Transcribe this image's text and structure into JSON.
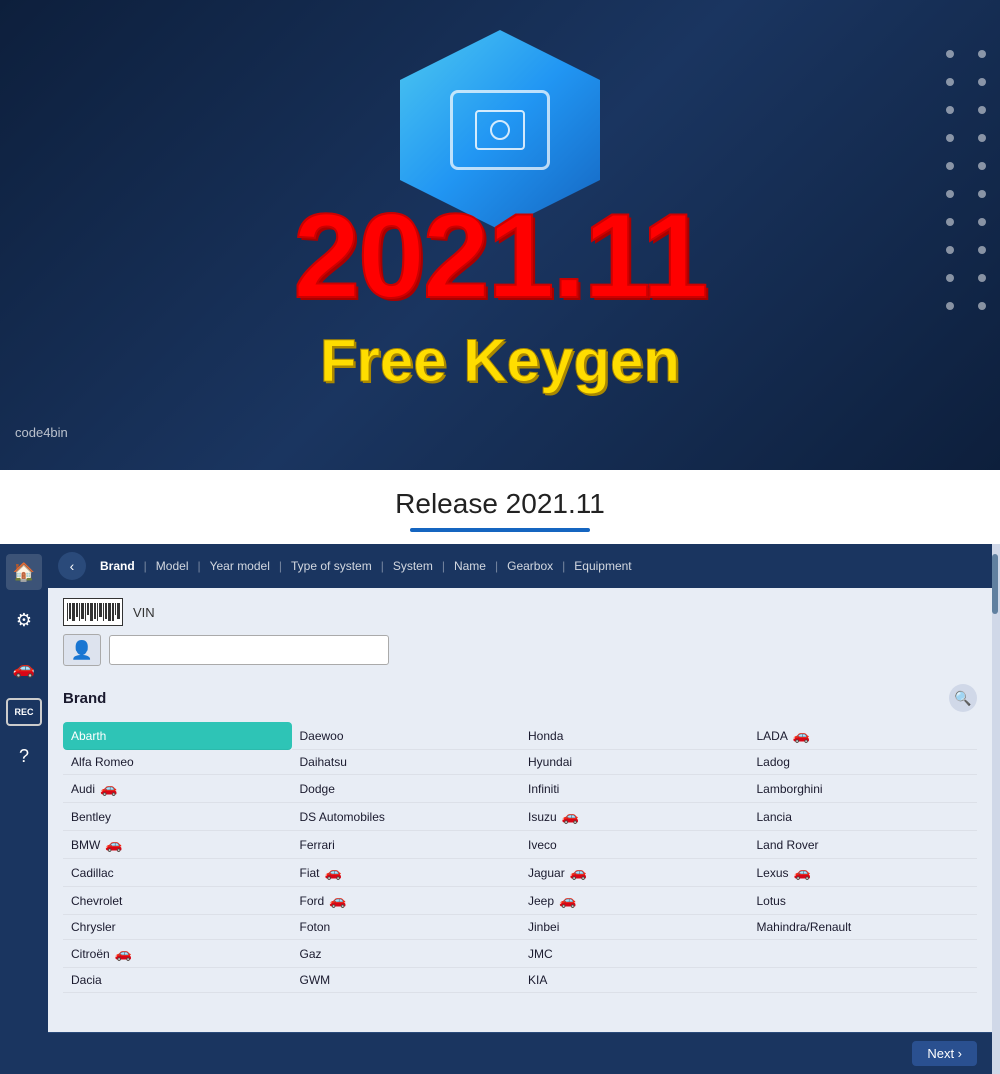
{
  "hero": {
    "version": "2021.11",
    "subtitle": "Free Keygen",
    "watermark": "code4bin"
  },
  "release_bar": {
    "title": "Release 2021.11"
  },
  "nav_tabs": {
    "back_label": "‹",
    "tabs": [
      "Brand",
      "Model",
      "Year model",
      "Type of system",
      "System",
      "Name",
      "Gearbox",
      "Equipment"
    ]
  },
  "vin_section": {
    "label": "VIN"
  },
  "brand_section": {
    "title": "Brand",
    "brands_col1": [
      "Abarth",
      "Alfa Romeo",
      "Audi",
      "Bentley",
      "BMW",
      "Cadillac",
      "Chevrolet",
      "Chrysler",
      "Citroën",
      "Dacia"
    ],
    "brands_col2": [
      "Daewoo",
      "Daihatsu",
      "Dodge",
      "DS Automobiles",
      "Ferrari",
      "Fiat",
      "Ford",
      "Foton",
      "Gaz",
      "GWM"
    ],
    "brands_col3": [
      "Honda",
      "Hyundai",
      "Infiniti",
      "Isuzu",
      "Iveco",
      "Jaguar",
      "Jeep",
      "Jinbei",
      "JMC",
      "KIA"
    ],
    "brands_col4": [
      "LADA",
      "Ladog",
      "Lamborghini",
      "Lancia",
      "Land Rover",
      "Lexus",
      "Lotus",
      "Mahindra/Renault"
    ],
    "car_icons_col1": [
      false,
      false,
      true,
      false,
      true,
      false,
      false,
      false,
      true,
      false
    ],
    "car_icons_col2": [
      false,
      false,
      false,
      false,
      false,
      true,
      true,
      false,
      false,
      false
    ],
    "car_icons_col3": [
      false,
      false,
      false,
      true,
      false,
      true,
      true,
      false,
      false,
      false
    ],
    "car_icons_col4": [
      true,
      false,
      false,
      false,
      false,
      true,
      false,
      false
    ],
    "selected": "Abarth"
  },
  "sidebar": {
    "icons": [
      "home",
      "settings",
      "car"
    ],
    "rec_label": "REC",
    "question_label": "?"
  },
  "bottom": {
    "next_label": "Next ›"
  }
}
